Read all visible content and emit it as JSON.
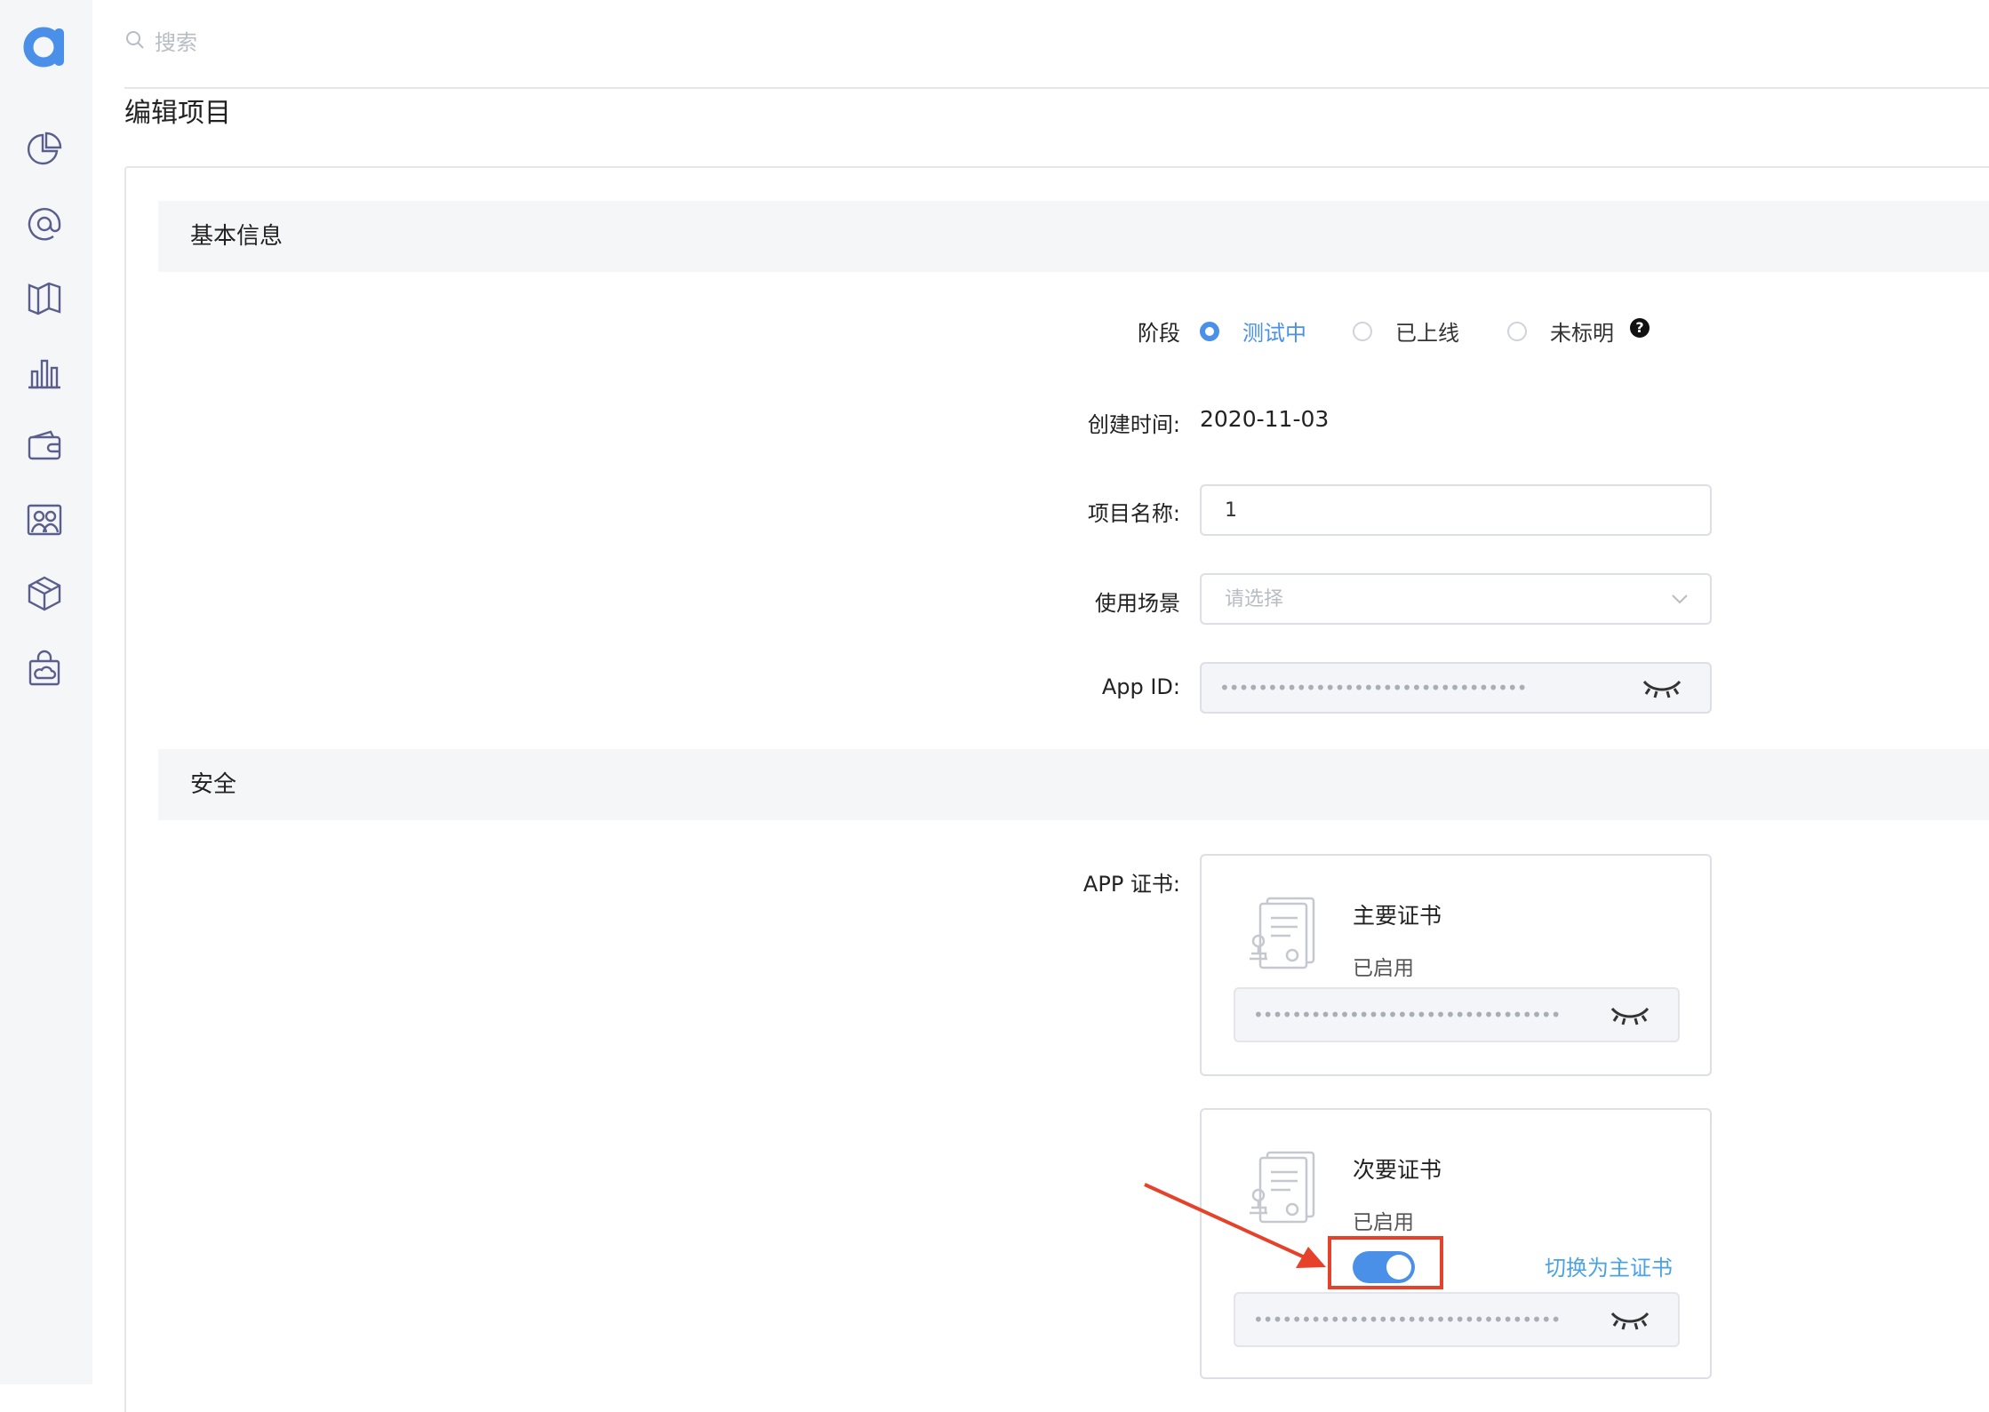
{
  "search": {
    "placeholder": "搜索"
  },
  "page": {
    "title": "编辑项目"
  },
  "sidebar": {
    "logo": "logo-icon",
    "items": [
      "pie-chart-icon",
      "at-icon",
      "map-icon",
      "bar-chart-icon",
      "wallet-icon",
      "users-icon",
      "box-icon",
      "bag-cloud-icon"
    ]
  },
  "basic": {
    "section_title": "基本信息",
    "stage": {
      "label": "阶段",
      "options": [
        "测试中",
        "已上线",
        "未标明"
      ],
      "selected": "测试中",
      "help_icon": "question-icon"
    },
    "created": {
      "label": "创建时间:",
      "value": "2020-11-03"
    },
    "name": {
      "label": "项目名称:",
      "value": "1"
    },
    "scene": {
      "label": "使用场景",
      "placeholder": "请选择"
    },
    "app_id": {
      "label": "App ID:",
      "masked": "••••••••••••••••••••••••••••••••"
    }
  },
  "security": {
    "section_title": "安全",
    "cert_label": "APP 证书:",
    "primary": {
      "title": "主要证书",
      "status": "已启用",
      "masked": "••••••••••••••••••••••••••••••••"
    },
    "secondary": {
      "title": "次要证书",
      "status": "已启用",
      "masked": "••••••••••••••••••••••••••••••••",
      "switch_label": "切换为主证书",
      "toggle_on": true
    }
  },
  "colors": {
    "accent": "#4a90e8",
    "highlight": "#e6412b",
    "link": "#4aa3e0"
  }
}
